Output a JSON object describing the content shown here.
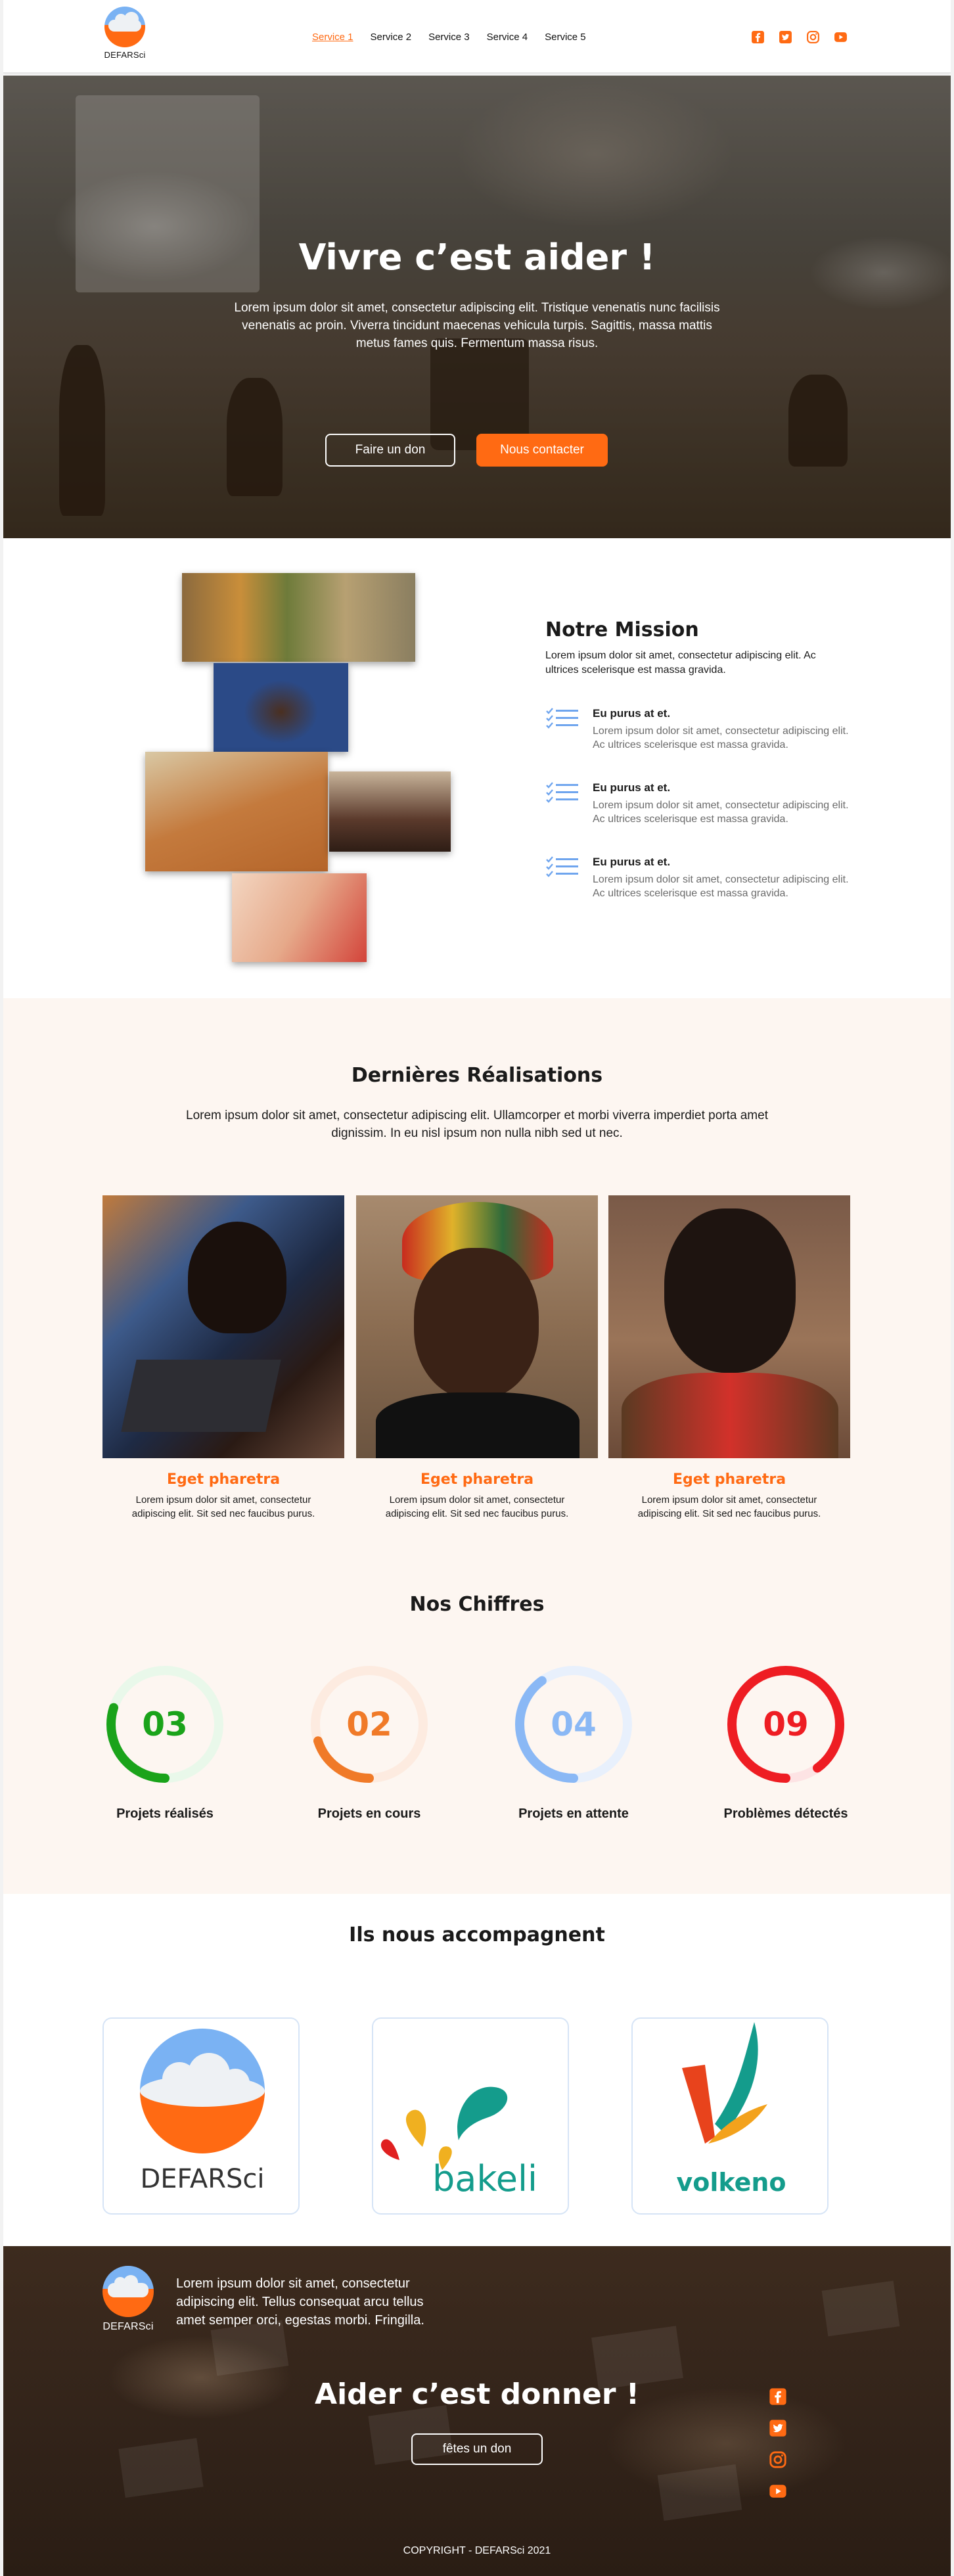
{
  "header": {
    "logo_text": "DEFARSci",
    "menu": [
      "Service 1",
      "Service 2",
      "Service 3",
      "Service 4",
      "Service 5"
    ],
    "socials": [
      "facebook-icon",
      "twitter-icon",
      "instagram-icon",
      "youtube-icon"
    ],
    "accent": "#ff6a13"
  },
  "hero": {
    "title": "Vivre c’est aider !",
    "text": "Lorem ipsum dolor sit amet, consectetur adipiscing elit. Tristique venenatis nunc facilisis venenatis ac proin. Viverra tincidunt maecenas vehicula turpis. Sagittis, massa mattis metus fames quis. Fermentum massa risus.",
    "btn_don": "Faire un don",
    "btn_contact": "Nous contacter"
  },
  "mission": {
    "title": "Notre Mission",
    "intro": "Lorem ipsum dolor sit amet, consectetur adipiscing elit. Ac ultrices scelerisque est massa gravida.",
    "features": [
      {
        "title": "Eu purus at et.",
        "text": "Lorem ipsum dolor sit amet, consectetur adipiscing elit. Ac ultrices scelerisque est massa gravida."
      },
      {
        "title": "Eu purus at et.",
        "text": "Lorem ipsum dolor sit amet, consectetur adipiscing elit. Ac ultrices scelerisque est massa gravida."
      },
      {
        "title": "Eu purus at et.",
        "text": "Lorem ipsum dolor sit amet, consectetur adipiscing elit. Ac ultrices scelerisque est massa gravida."
      }
    ]
  },
  "realisations": {
    "title": "Dernières Réalisations",
    "text": "Lorem ipsum dolor sit amet, consectetur adipiscing elit. Ullamcorper et morbi viverra imperdiet porta amet dignissim. In eu nisl ipsum non nulla nibh sed ut nec.",
    "cards": [
      {
        "title": "Eget pharetra",
        "text": "Lorem ipsum dolor sit amet, consectetur adipiscing elit. Sit sed nec faucibus purus."
      },
      {
        "title": "Eget pharetra",
        "text": "Lorem ipsum dolor sit amet, consectetur adipiscing elit. Sit sed nec faucibus purus."
      },
      {
        "title": "Eget pharetra",
        "text": "Lorem ipsum dolor sit amet, consectetur adipiscing elit. Sit sed nec faucibus purus."
      }
    ]
  },
  "chiffres": {
    "title": "Nos Chiffres",
    "stats": [
      {
        "value": "03",
        "label": "Projets réalisés",
        "color": "#1aa31a",
        "track": "#e9f8ea",
        "fraction": 0.3
      },
      {
        "value": "02",
        "label": "Projets en cours",
        "color": "#f07a28",
        "track": "#fdebe0",
        "fraction": 0.2
      },
      {
        "value": "04",
        "label": "Projets en attente",
        "color": "#8ab8f5",
        "track": "#e8f0fc",
        "fraction": 0.4
      },
      {
        "value": "09",
        "label": "Problèmes détectés",
        "color": "#ee1d23",
        "track": "#fde3e4",
        "fraction": 0.9
      }
    ]
  },
  "partners": {
    "title": "Ils nous accompagnent",
    "names": [
      "DEFARSci",
      "bakeli",
      "volkeno"
    ]
  },
  "footer": {
    "logo_text": "DEFARSci",
    "text": "Lorem ipsum dolor sit amet, consectetur adipiscing elit. Tellus consequat arcu tellus amet semper orci, egestas morbi. Fringilla.",
    "slogan": "Aider c’est donner !",
    "btn_don": "fêtes un don",
    "copyright": "COPYRIGHT - DEFARSci 2021"
  }
}
